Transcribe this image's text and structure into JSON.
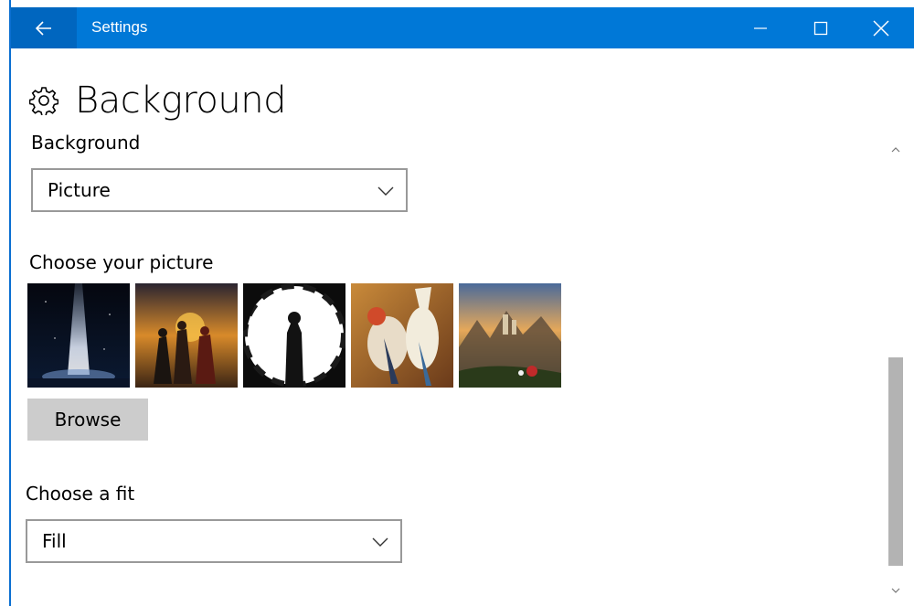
{
  "window": {
    "title": "Settings",
    "accent": "#0078d7"
  },
  "page": {
    "title": "Background",
    "icon": "gear-icon"
  },
  "background_section": {
    "label": "Background",
    "selected": "Picture"
  },
  "picture_section": {
    "label": "Choose your picture",
    "thumbnails": [
      "space-beam",
      "adventurers-sunset",
      "gunbarrel-silhouette",
      "rabbit-and-dog-cartoon",
      "fantasy-castle-landscape"
    ],
    "browse_label": "Browse"
  },
  "fit_section": {
    "label": "Choose a fit",
    "selected": "Fill"
  }
}
